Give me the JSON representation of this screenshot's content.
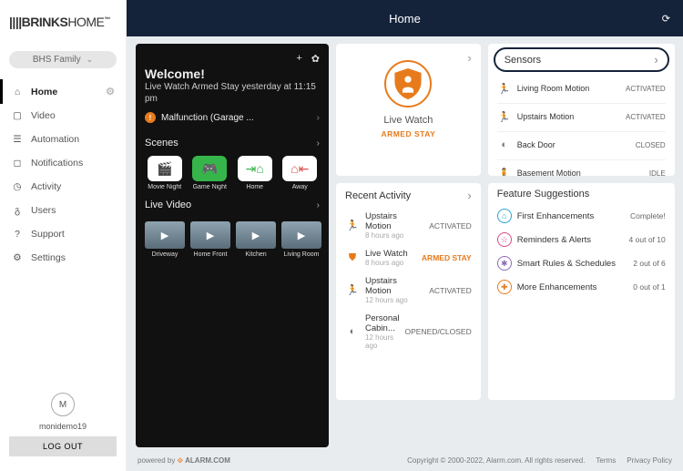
{
  "brand": {
    "bold": "BRINKS",
    "light": "HOME",
    "tm": "™"
  },
  "family": "BHS Family",
  "nav": {
    "home": "Home",
    "video": "Video",
    "automation": "Automation",
    "notifications": "Notifications",
    "activity": "Activity",
    "users": "Users",
    "support": "Support",
    "settings": "Settings"
  },
  "user": {
    "initial": "M",
    "name": "monidemo19",
    "logout": "LOG OUT"
  },
  "topbar": {
    "title": "Home"
  },
  "welcome": {
    "title": "Welcome!",
    "sub": "Live Watch Armed Stay yesterday at 11:15 pm",
    "malfunction": "Malfunction (Garage ...",
    "scenes_label": "Scenes",
    "scenes": {
      "movie": "Movie Night",
      "game": "Game Night",
      "home": "Home",
      "away": "Away"
    },
    "live_video_label": "Live Video",
    "videos": {
      "driveway": "Driveway",
      "front": "Home Front",
      "kitchen": "Kitchen",
      "living": "Living Room"
    }
  },
  "shield": {
    "title": "Live Watch",
    "status": "ARMED STAY"
  },
  "sensors": {
    "title": "Sensors",
    "items": [
      {
        "name": "Living Room Motion",
        "status": "ACTIVATED"
      },
      {
        "name": "Upstairs Motion",
        "status": "ACTIVATED"
      },
      {
        "name": "Back Door",
        "status": "CLOSED"
      },
      {
        "name": "Basement Motion",
        "status": "IDLE"
      }
    ]
  },
  "recent": {
    "title": "Recent Activity",
    "items": [
      {
        "name": "Upstairs Motion",
        "time": "8 hours ago",
        "status": "ACTIVATED",
        "icon": "run"
      },
      {
        "name": "Live Watch",
        "time": "8 hours ago",
        "status": "ARMED STAY",
        "icon": "shield",
        "orange": true
      },
      {
        "name": "Upstairs Motion",
        "time": "12 hours ago",
        "status": "ACTIVATED",
        "icon": "run"
      },
      {
        "name": "Personal Cabin...",
        "time": "12 hours ago",
        "status": "OPENED/CLOSED",
        "icon": "door"
      }
    ]
  },
  "features": {
    "title": "Feature Suggestions",
    "items": [
      {
        "name": "First Enhancements",
        "status": "Complete!"
      },
      {
        "name": "Reminders & Alerts",
        "status": "4 out of 10"
      },
      {
        "name": "Smart Rules & Schedules",
        "status": "2 out of 6"
      },
      {
        "name": "More Enhancements",
        "status": "0 out of 1"
      }
    ]
  },
  "footer": {
    "powered": "powered by ",
    "alarm": "ALARM.COM",
    "copy": "Copyright © 2000-2022, Alarm.com. All rights reserved.",
    "terms": "Terms",
    "privacy": "Privacy Policy"
  }
}
